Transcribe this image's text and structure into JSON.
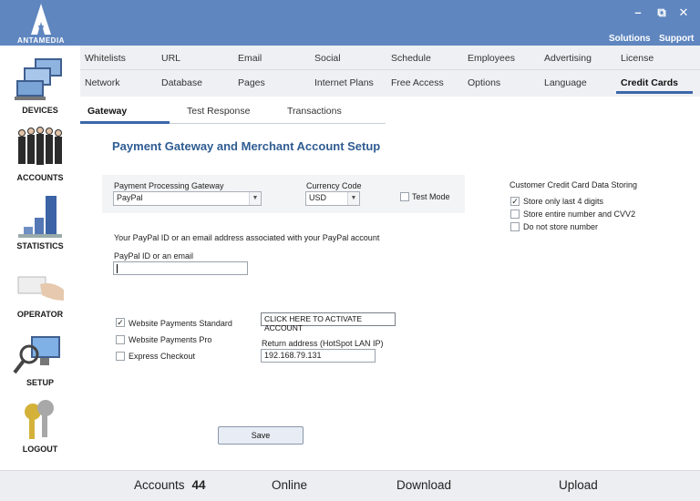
{
  "app": {
    "logo_text": "ANTAMEDIA",
    "window_buttons": [
      "–",
      "⧉",
      "✕"
    ],
    "top_links": [
      "Solutions",
      "Support"
    ]
  },
  "sidebar": {
    "items": [
      {
        "label": "DEVICES",
        "icon": "devices-icon"
      },
      {
        "label": "ACCOUNTS",
        "icon": "accounts-icon"
      },
      {
        "label": "STATISTICS",
        "icon": "statistics-icon"
      },
      {
        "label": "OPERATOR",
        "icon": "operator-icon"
      },
      {
        "label": "SETUP",
        "icon": "setup-icon"
      },
      {
        "label": "LOGOUT",
        "icon": "logout-icon"
      }
    ]
  },
  "tabs": {
    "row1": [
      "Whitelists",
      "URL",
      "Email",
      "Social",
      "Schedule",
      "Employees",
      "Advertising",
      "License"
    ],
    "row2": [
      "Network",
      "Database",
      "Pages",
      "Internet Plans",
      "Free Access",
      "Options",
      "Language",
      "Credit Cards"
    ]
  },
  "subtabs": [
    "Gateway",
    "Test Response",
    "Transactions"
  ],
  "content": {
    "title": "Payment Gateway and Merchant Account Setup",
    "gateway_label": "Payment Processing Gateway",
    "gateway_value": "PayPal",
    "currency_label": "Currency Code",
    "currency_value": "USD",
    "test_mode_label": "Test Mode",
    "storing_title": "Customer Credit Card Data Storing",
    "storing_options": [
      {
        "label": "Store only last 4 digits",
        "checked": true
      },
      {
        "label": "Store entire number and CVV2",
        "checked": false
      },
      {
        "label": "Do not store number",
        "checked": false
      }
    ],
    "paypal_info": "Your PayPal ID or an email address associated with your PayPal account",
    "paypal_field_label": "PayPal ID or an email",
    "paypal_field_value": "",
    "payment_options": [
      {
        "label": "Website Payments Standard",
        "checked": true
      },
      {
        "label": "Website Payments Pro",
        "checked": false
      },
      {
        "label": "Express Checkout",
        "checked": false
      }
    ],
    "activate_button": "CLICK HERE TO ACTIVATE ACCOUNT",
    "return_label": "Return address (HotSpot LAN IP)",
    "return_value": "192.168.79.131",
    "save_button": "Save"
  },
  "statusbar": {
    "accounts_label": "Accounts",
    "accounts_count": "44",
    "online_label": "Online",
    "download_label": "Download",
    "upload_label": "Upload"
  },
  "colors": {
    "titlebar": "#5f86bf",
    "accent": "#3c66a8",
    "title_text": "#2f5c92"
  }
}
